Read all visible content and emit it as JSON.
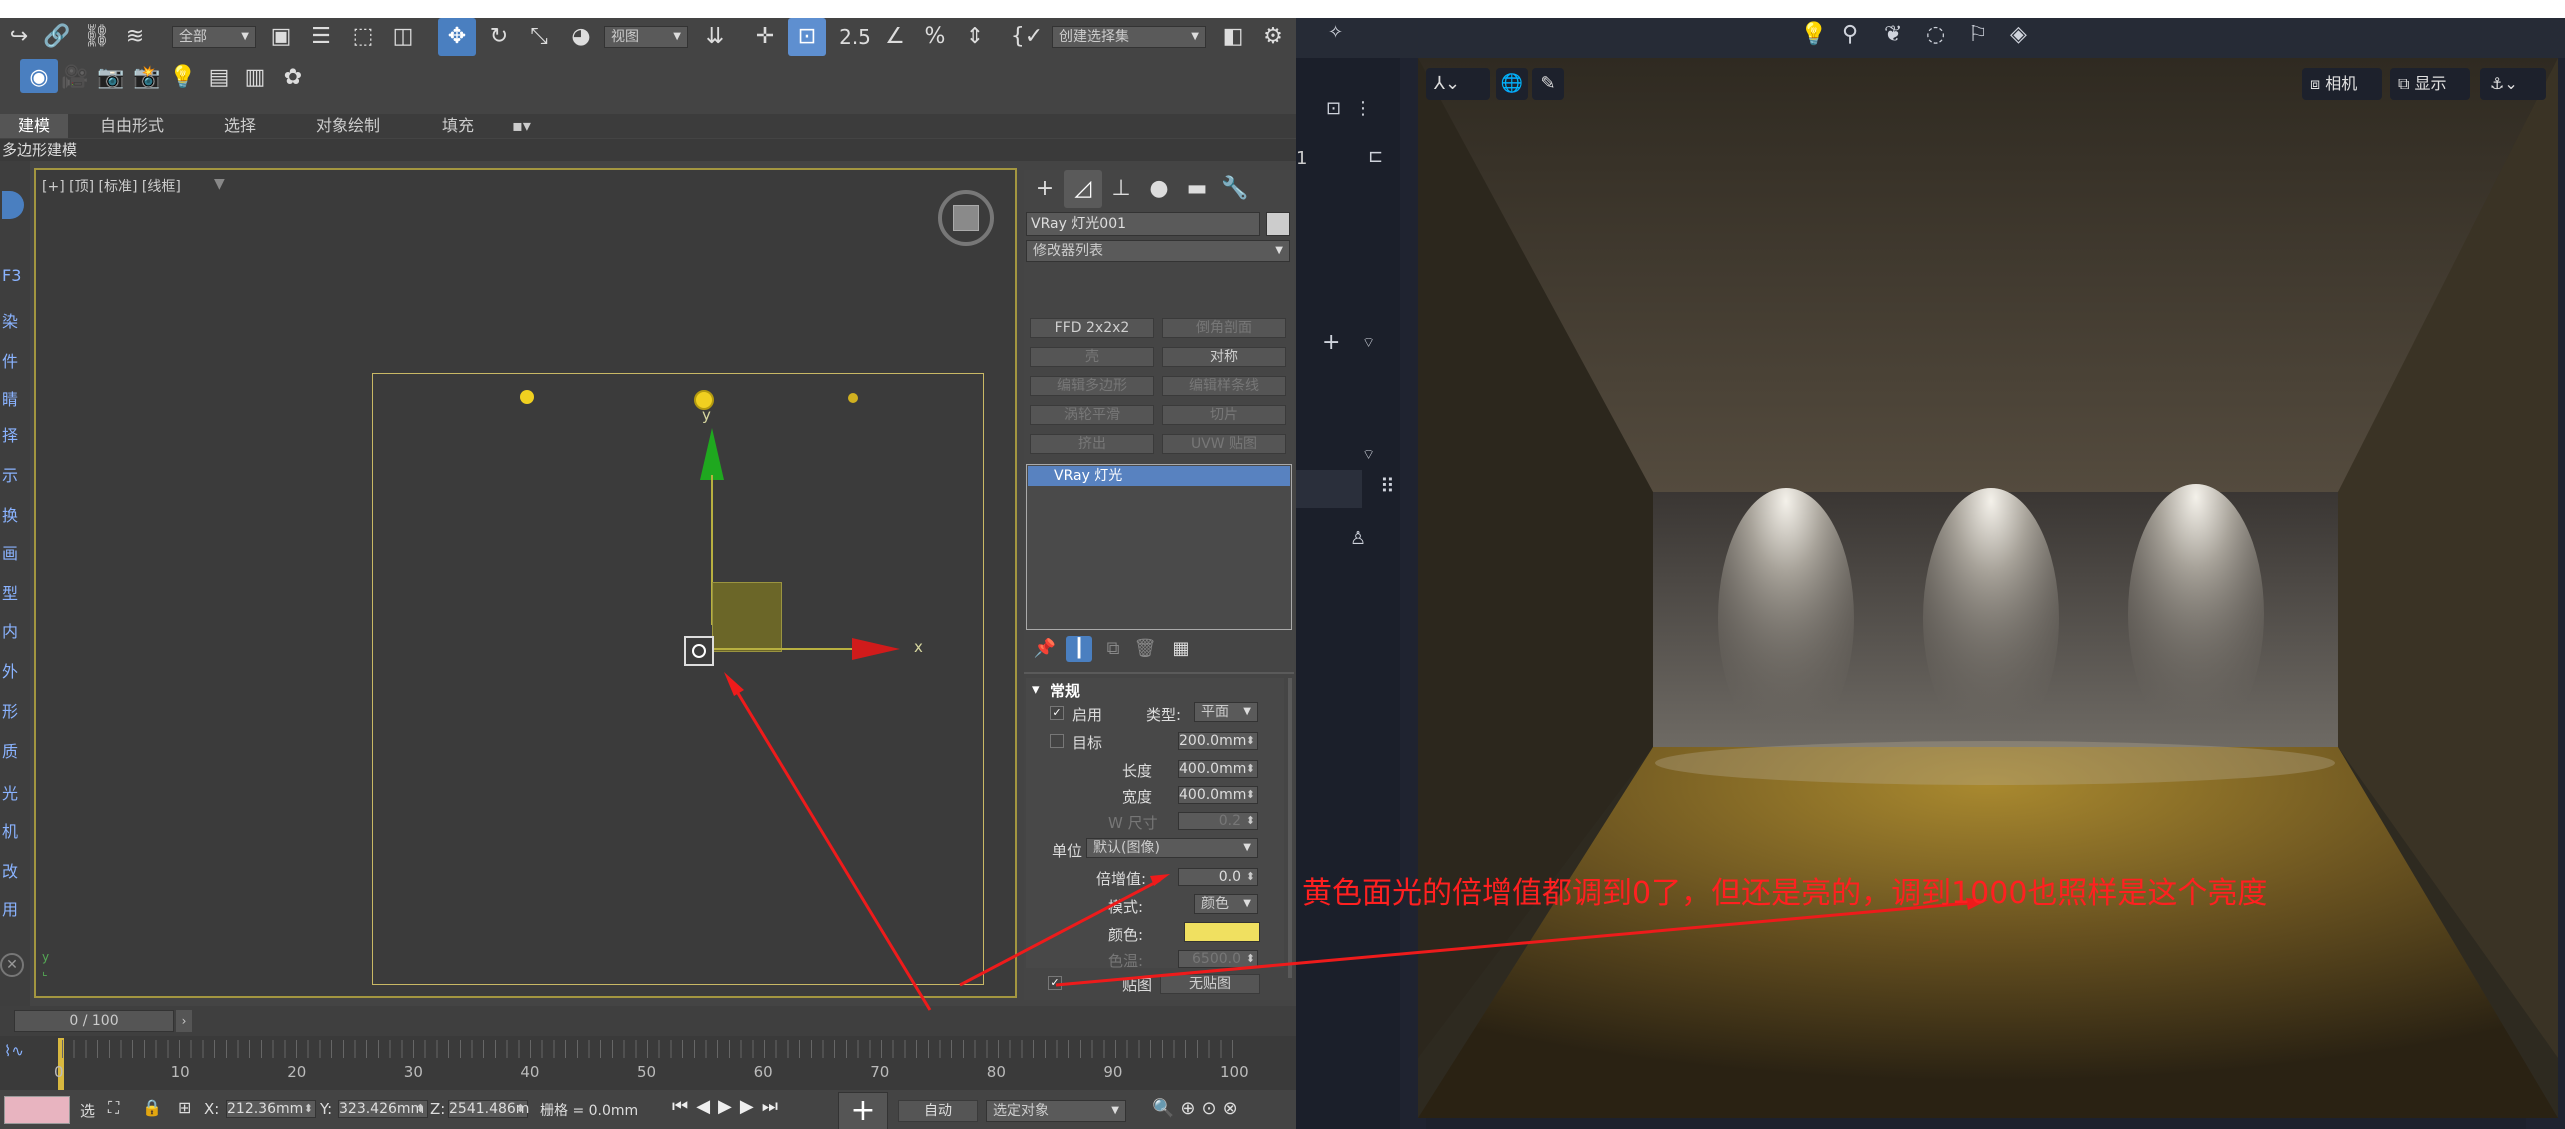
{
  "toolbar": {
    "selection_filter": "全部",
    "ref_coord": "视图",
    "named_selection": "创建选择集",
    "snap_label": "2.5",
    "angle_snap": "∠",
    "percent_snap": "%",
    "spinner_snap": "⇕"
  },
  "ribbon": {
    "tabs": [
      "建模",
      "自由形式",
      "选择",
      "对象绘制",
      "填充"
    ],
    "sub_label": "多边形建模"
  },
  "left_strip_chars": [
    "F3",
    "染",
    "件",
    "睛",
    "择",
    "示",
    "换",
    "画",
    "型",
    "内",
    "外",
    "形",
    "质",
    "光",
    "机",
    "改",
    "用"
  ],
  "viewport": {
    "label": "[+] [顶] [标准] [线框]",
    "axis_y": "y",
    "axis_x": "x"
  },
  "command_panel": {
    "object_name": "VRay 灯光001",
    "modifier_list": "修改器列表",
    "modifier_buttons": [
      {
        "label": "FFD 2x2x2",
        "enabled": true
      },
      {
        "label": "倒角剖面",
        "enabled": false
      },
      {
        "label": "壳",
        "enabled": false
      },
      {
        "label": "对称",
        "enabled": true
      },
      {
        "label": "编辑多边形",
        "enabled": false
      },
      {
        "label": "编辑样条线",
        "enabled": false
      },
      {
        "label": "涡轮平滑",
        "enabled": false
      },
      {
        "label": "切片",
        "enabled": false
      },
      {
        "label": "挤出",
        "enabled": false
      },
      {
        "label": "UVW 贴图",
        "enabled": false
      }
    ],
    "stack_item": "VRay 灯光",
    "section_title": "常规",
    "enable_label": "启用",
    "type_label": "类型:",
    "type_value": "平面",
    "target_label": "目标",
    "target_value": "200.0mm",
    "length_label": "长度",
    "length_value": "400.0mm",
    "width_label": "宽度",
    "width_value": "400.0mm",
    "w_size_label": "W 尺寸",
    "w_size_value": "0.2",
    "unit_label": "单位",
    "unit_value": "默认(图像)",
    "multiplier_label": "倍增值:",
    "multiplier_value": "0.0",
    "mode_label": "模式:",
    "mode_value": "颜色",
    "color_label": "颜色:",
    "color_swatch": "#f0e060",
    "temp_label": "色温:",
    "temp_value": "6500.0",
    "map_label": "贴图",
    "map_value": "无贴图"
  },
  "timeline": {
    "frame_counter": "0 / 100",
    "ticks": [
      "0",
      "10",
      "20",
      "30",
      "40",
      "50",
      "60",
      "70",
      "80",
      "90",
      "100"
    ]
  },
  "status_bar": {
    "select_label": "选",
    "x_label": "X:",
    "x_value": "212.36mm",
    "y_label": "Y:",
    "y_value": "323.426mm",
    "z_label": "Z:",
    "z_value": "2541.486m",
    "grid_text": "栅格 = 0.0mm",
    "auto_key": "自动",
    "selected_object": "选定对象"
  },
  "right_panel": {
    "camera_button": "相机",
    "display_button": "显示",
    "side_number": "1"
  },
  "annotation": {
    "text": "黄色面光的倍增值都调到0了，但还是亮的，调到1000也照样是这个亮度",
    "color": "#ff2020"
  }
}
